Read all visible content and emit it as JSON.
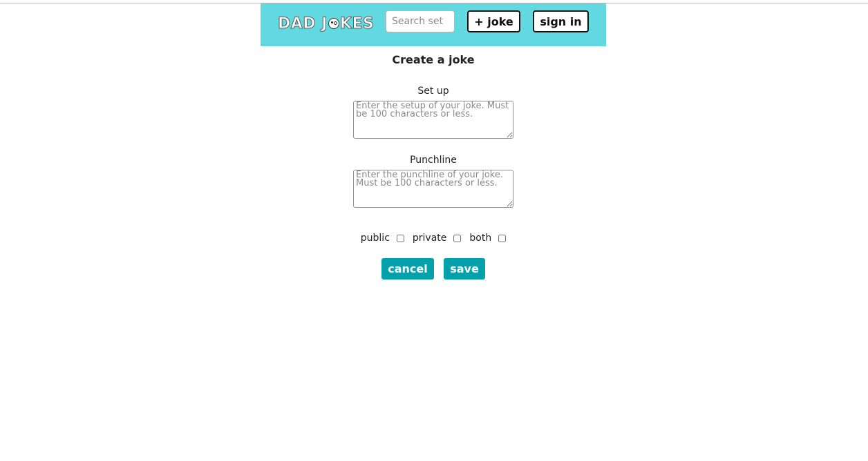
{
  "header": {
    "logo_text_left": "DAD J",
    "logo_text_right": "KES",
    "logo_icon": "winking-face-icon",
    "search": {
      "placeholder": "Search set",
      "value": ""
    },
    "add_joke_label": "+ joke",
    "sign_in_label": "sign in",
    "background_color": "#62d8e0"
  },
  "form": {
    "title": "Create a joke",
    "setup": {
      "label": "Set up",
      "placeholder": "Enter the setup of your joke. Must be 100 characters or less.",
      "value": ""
    },
    "punchline": {
      "label": "Punchline",
      "placeholder": "Enter the punchline of your joke. Must be 100 characters or less.",
      "value": ""
    },
    "visibility": {
      "options": [
        {
          "label": "public",
          "checked": false
        },
        {
          "label": "private",
          "checked": false
        },
        {
          "label": "both",
          "checked": false
        }
      ]
    },
    "cancel_label": "cancel",
    "save_label": "save",
    "accent_color": "#03a1ab"
  }
}
